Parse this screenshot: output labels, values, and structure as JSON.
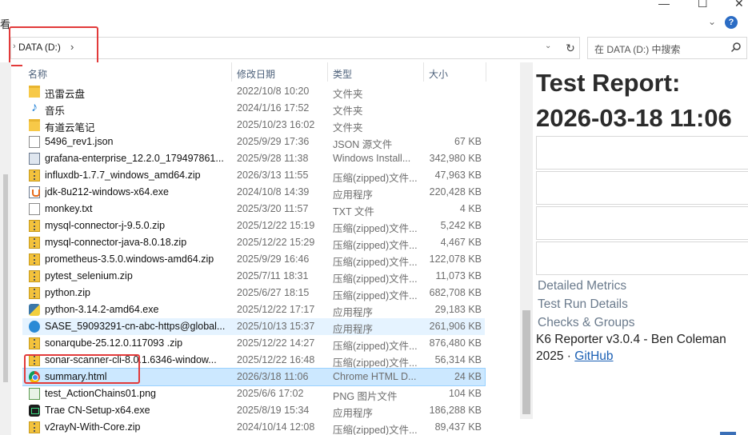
{
  "window": {
    "truncated_left_text": "看",
    "controls": [
      "—",
      "☐",
      "✕"
    ]
  },
  "address": {
    "path_label": "DATA (D:)",
    "separator": "›",
    "search_placeholder": "在 DATA (D:) 中搜索"
  },
  "columns": {
    "name": "名称",
    "date": "修改日期",
    "type": "类型",
    "size": "大小"
  },
  "files": [
    {
      "name": "迅雷云盘",
      "date": "2022/10/8 10:20",
      "type": "文件夹",
      "size": "",
      "icon": "folder-icon",
      "state": ""
    },
    {
      "name": "音乐",
      "date": "2024/1/16 17:52",
      "type": "文件夹",
      "size": "",
      "icon": "music-folder-icon",
      "state": ""
    },
    {
      "name": "有道云笔记",
      "date": "2025/10/23 16:02",
      "type": "文件夹",
      "size": "",
      "icon": "folder-icon",
      "state": ""
    },
    {
      "name": "5496_rev1.json",
      "date": "2025/9/29 17:36",
      "type": "JSON 源文件",
      "size": "67 KB",
      "icon": "json-file-icon",
      "state": ""
    },
    {
      "name": "grafana-enterprise_12.2.0_179497861...",
      "date": "2025/9/28 11:38",
      "type": "Windows Install...",
      "size": "342,980 KB",
      "icon": "installer-icon",
      "state": ""
    },
    {
      "name": "influxdb-1.7.7_windows_amd64.zip",
      "date": "2026/3/13 11:55",
      "type": "压缩(zipped)文件...",
      "size": "47,963 KB",
      "icon": "zip-icon",
      "state": ""
    },
    {
      "name": "jdk-8u212-windows-x64.exe",
      "date": "2024/10/8 14:39",
      "type": "应用程序",
      "size": "220,428 KB",
      "icon": "java-icon",
      "state": ""
    },
    {
      "name": "monkey.txt",
      "date": "2025/3/20 11:57",
      "type": "TXT 文件",
      "size": "4 KB",
      "icon": "text-file-icon",
      "state": ""
    },
    {
      "name": "mysql-connector-j-9.5.0.zip",
      "date": "2025/12/22 15:19",
      "type": "压缩(zipped)文件...",
      "size": "5,242 KB",
      "icon": "zip-icon",
      "state": ""
    },
    {
      "name": "mysql-connector-java-8.0.18.zip",
      "date": "2025/12/22 15:29",
      "type": "压缩(zipped)文件...",
      "size": "4,467 KB",
      "icon": "zip-icon",
      "state": ""
    },
    {
      "name": "prometheus-3.5.0.windows-amd64.zip",
      "date": "2025/9/29 16:46",
      "type": "压缩(zipped)文件...",
      "size": "122,078 KB",
      "icon": "zip-icon",
      "state": ""
    },
    {
      "name": "pytest_selenium.zip",
      "date": "2025/7/11 18:31",
      "type": "压缩(zipped)文件...",
      "size": "11,073 KB",
      "icon": "zip-icon",
      "state": ""
    },
    {
      "name": "python.zip",
      "date": "2025/6/27 18:15",
      "type": "压缩(zipped)文件...",
      "size": "682,708 KB",
      "icon": "zip-icon",
      "state": ""
    },
    {
      "name": "python-3.14.2-amd64.exe",
      "date": "2025/12/22 17:17",
      "type": "应用程序",
      "size": "29,183 KB",
      "icon": "python-icon",
      "state": ""
    },
    {
      "name": "SASE_59093291-cn-abc-https@global...",
      "date": "2025/10/13 15:37",
      "type": "应用程序",
      "size": "261,906 KB",
      "icon": "edge-app-icon",
      "state": "hover"
    },
    {
      "name": "sonarqube-25.12.0.117093 .zip",
      "date": "2025/12/22 14:27",
      "type": "压缩(zipped)文件...",
      "size": "876,480 KB",
      "icon": "zip-icon",
      "state": ""
    },
    {
      "name": "sonar-scanner-cli-8.0.1.6346-window...",
      "date": "2025/12/22 16:48",
      "type": "压缩(zipped)文件...",
      "size": "56,314 KB",
      "icon": "zip-icon",
      "state": ""
    },
    {
      "name": "summary.html",
      "date": "2026/3/18 11:06",
      "type": "Chrome HTML D...",
      "size": "24 KB",
      "icon": "chrome-html-icon",
      "state": "selected"
    },
    {
      "name": "test_ActionChains01.png",
      "date": "2025/6/6 17:02",
      "type": "PNG 图片文件",
      "size": "104 KB",
      "icon": "png-file-icon",
      "state": ""
    },
    {
      "name": "Trae CN-Setup-x64.exe",
      "date": "2025/8/19 15:34",
      "type": "应用程序",
      "size": "186,288 KB",
      "icon": "trae-icon",
      "state": ""
    },
    {
      "name": "v2rayN-With-Core.zip",
      "date": "2024/10/14 12:08",
      "type": "压缩(zipped)文件...",
      "size": "89,437 KB",
      "icon": "zip-icon",
      "state": ""
    }
  ],
  "preview": {
    "title_line1": "Test Report:",
    "title_line2": "2026-03-18 11:06",
    "links": [
      "Detailed Metrics",
      "Test Run Details",
      "Checks & Groups"
    ],
    "footer_line1": "K6 Reporter v3.0.4 - Ben Coleman",
    "footer_year": "2025 · ",
    "footer_link": "GitHub"
  },
  "colors": {
    "highlight_red": "#e23a3a",
    "selection_bg": "#cce8ff",
    "hover_bg": "#e5f3ff",
    "link_blue": "#1a5fb4"
  }
}
